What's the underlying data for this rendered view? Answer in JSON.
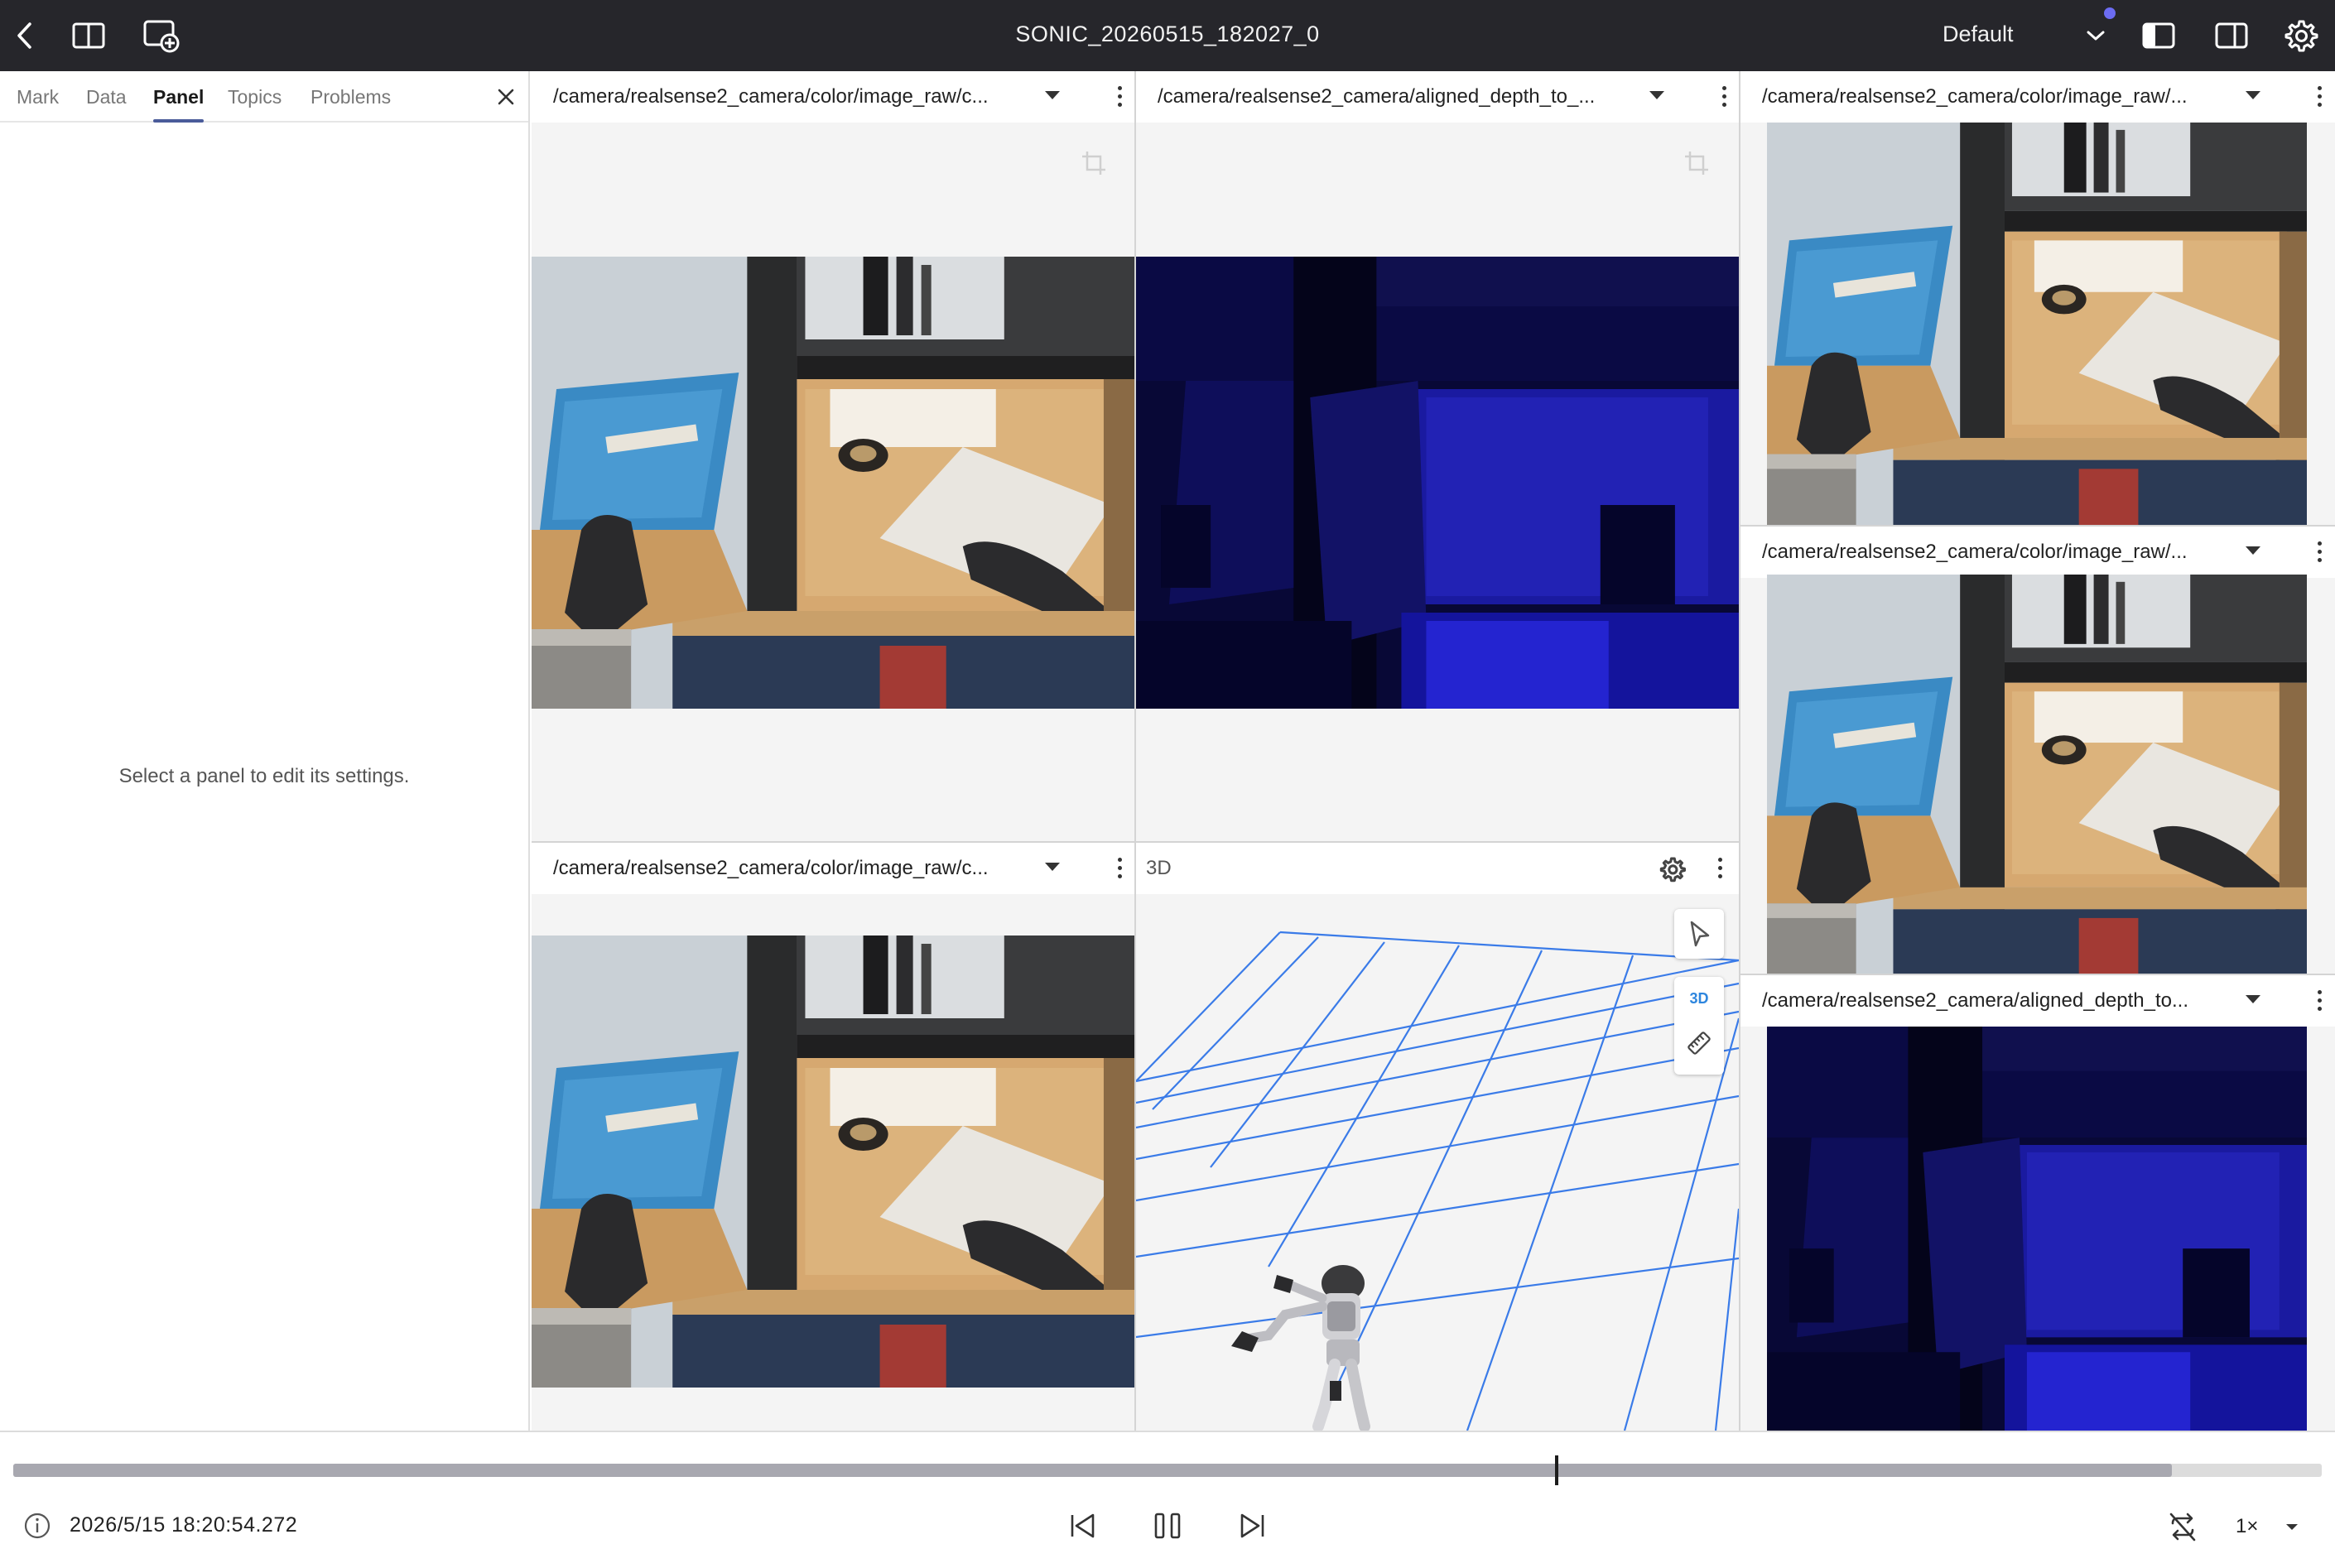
{
  "app": {
    "title": "SONIC_20260515_182027_0",
    "layout_name": "Default"
  },
  "sidebar": {
    "tabs": [
      {
        "label": "Mark"
      },
      {
        "label": "Data"
      },
      {
        "label": "Panel"
      },
      {
        "label": "Topics"
      },
      {
        "label": "Problems"
      }
    ],
    "active_tab": "Panel",
    "empty_message": "Select a panel to edit its settings."
  },
  "panels": {
    "p1": {
      "title": "/camera/realsense2_camera/color/image_raw/c...",
      "kind": "color"
    },
    "p2": {
      "title": "/camera/realsense2_camera/aligned_depth_to_...",
      "kind": "depth"
    },
    "p3": {
      "title": "/camera/realsense2_camera/color/image_raw/c...",
      "kind": "color"
    },
    "p4": {
      "title": "3D",
      "kind": "3d"
    },
    "p5": {
      "title": "/camera/realsense2_camera/color/image_raw/...",
      "kind": "color"
    },
    "p6": {
      "title": "/camera/realsense2_camera/color/image_raw/...",
      "kind": "color"
    },
    "p7": {
      "title": "/camera/realsense2_camera/aligned_depth_to...",
      "kind": "depth"
    }
  },
  "tools3d": {
    "mode_label": "3D"
  },
  "playback": {
    "timestamp": "2026/5/15 18:20:54.272",
    "speed": "1×",
    "progress": 0.935,
    "cursor": 0.668
  },
  "colors": {
    "topbar": "#26262b",
    "accent": "#4a5b9a",
    "grid": "#3a7be8",
    "depth_dark": "#05052a",
    "depth_blue": "#1a1aa0"
  }
}
